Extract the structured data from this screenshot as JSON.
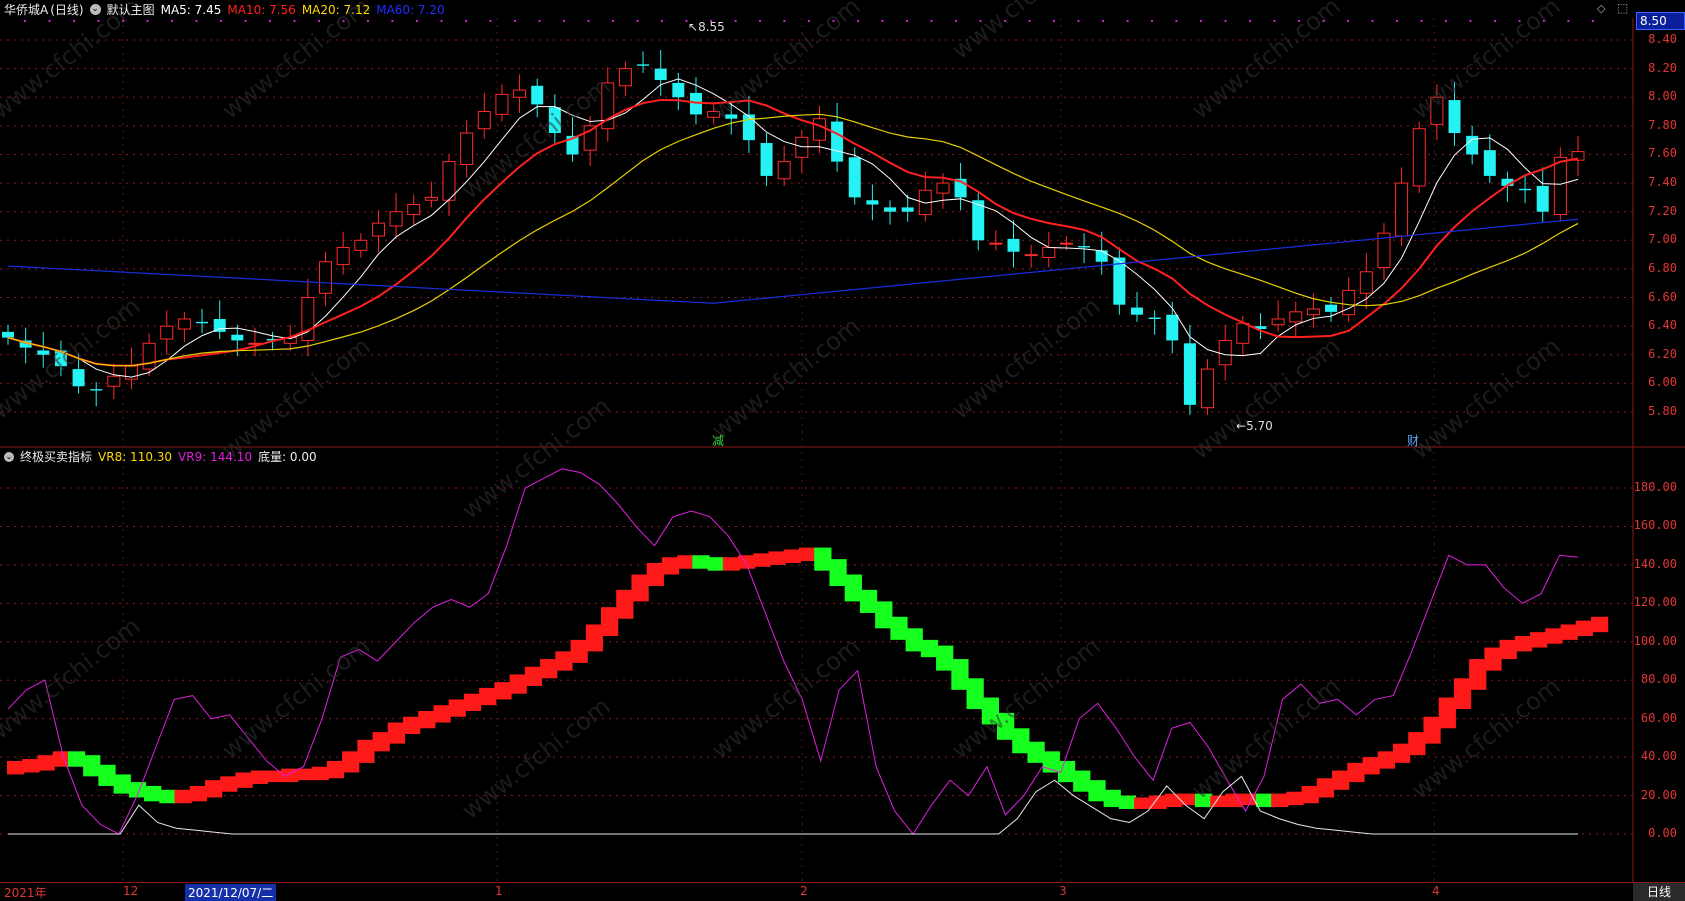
{
  "header": {
    "stock_name": "华侨城A",
    "period_tag": "(日线)",
    "main_chart_label": "默认主图",
    "ma": [
      {
        "label": "MA5: 7.45",
        "color": "#ffffff"
      },
      {
        "label": "MA10: 7.56",
        "color": "#ff2020"
      },
      {
        "label": "MA20: 7.12",
        "color": "#ffd800"
      },
      {
        "label": "MA60: 7.20",
        "color": "#2030ff"
      }
    ]
  },
  "price_panel": {
    "current_price_tag": "8.50",
    "y_ticks": [
      "8.40",
      "8.20",
      "8.00",
      "7.80",
      "7.60",
      "7.40",
      "7.20",
      "7.00",
      "6.80",
      "6.60",
      "6.40",
      "6.20",
      "6.00",
      "5.80"
    ],
    "high_annotation": "8.55",
    "low_annotation": "5.70",
    "event_marks": [
      {
        "text": "减",
        "color": "#3cd23c"
      },
      {
        "text": "财",
        "color": "#5aa8ff"
      }
    ]
  },
  "indicator_panel": {
    "name": "终极买卖指标",
    "vr8": "VR8: 110.30",
    "vr9": "VR9: 144.10",
    "bottom_vol": "底量: 0.00",
    "y_ticks": [
      "180.00",
      "160.00",
      "140.00",
      "120.00",
      "100.00",
      "80.00",
      "60.00",
      "40.00",
      "20.00",
      "0.00"
    ]
  },
  "x_axis": {
    "labels": [
      "2021年",
      "12",
      "1",
      "2",
      "3",
      "4"
    ],
    "selected_date": "2021/12/07/二",
    "period_button": "日线"
  },
  "watermark": "www.cfchi.com",
  "colors": {
    "up": "#ff2a2a",
    "down": "#25f2f2",
    "ma5": "#ffffff",
    "ma10": "#ff2020",
    "ma20": "#e6d200",
    "ma60": "#1a2ee0",
    "vr_up": "#ff1a1a",
    "vr_down": "#17ff1f",
    "vr9": "#e020e0",
    "grid": "#8b1a1a"
  }
}
